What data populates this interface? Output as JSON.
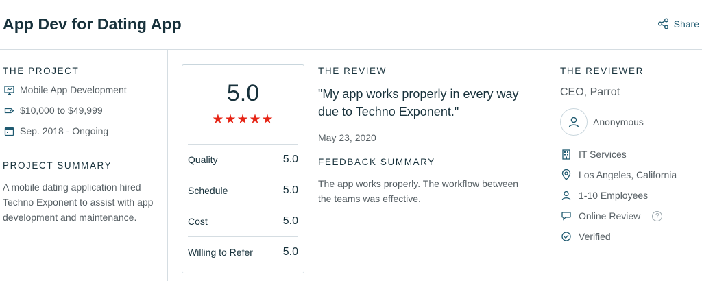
{
  "header": {
    "title": "App Dev for Dating App",
    "share_label": "Share",
    "share_icon": "share-icon"
  },
  "project": {
    "heading": "THE PROJECT",
    "items": [
      {
        "icon": "monitor-icon",
        "text": "Mobile App Development"
      },
      {
        "icon": "price-tag-icon",
        "text": "$10,000 to $49,999"
      },
      {
        "icon": "calendar-icon",
        "text": "Sep. 2018 - Ongoing"
      }
    ],
    "summary_heading": "PROJECT SUMMARY",
    "summary_text": "A mobile dating application hired Techno Exponent to assist with app development and maintenance."
  },
  "rating": {
    "overall": "5.0",
    "stars": "★★★★★",
    "star_count": 5,
    "star_color": "#e62415",
    "rows": [
      {
        "label": "Quality",
        "value": "5.0"
      },
      {
        "label": "Schedule",
        "value": "5.0"
      },
      {
        "label": "Cost",
        "value": "5.0"
      },
      {
        "label": "Willing to Refer",
        "value": "5.0"
      }
    ]
  },
  "review": {
    "heading": "THE REVIEW",
    "quote": "\"My app works properly in every way due to Techno Exponent.\"",
    "date": "May 23, 2020",
    "feedback_heading": "FEEDBACK SUMMARY",
    "feedback_text": "The app works properly. The workflow between the teams was effective."
  },
  "reviewer": {
    "heading": "THE REVIEWER",
    "title": "CEO, Parrot",
    "name": "Anonymous",
    "avatar_icon": "user-icon",
    "items": [
      {
        "icon": "building-icon",
        "text": "IT Services"
      },
      {
        "icon": "location-pin-icon",
        "text": "Los Angeles, California"
      },
      {
        "icon": "person-icon",
        "text": "1-10 Employees"
      },
      {
        "icon": "chat-bubble-icon",
        "text": "Online Review",
        "help": "?"
      },
      {
        "icon": "check-circle-icon",
        "text": "Verified"
      }
    ]
  },
  "colors": {
    "accent": "#1f5a70",
    "text_dark": "#17313b",
    "text_muted": "#555e63",
    "star": "#e62415",
    "divider": "#d5dde2"
  }
}
